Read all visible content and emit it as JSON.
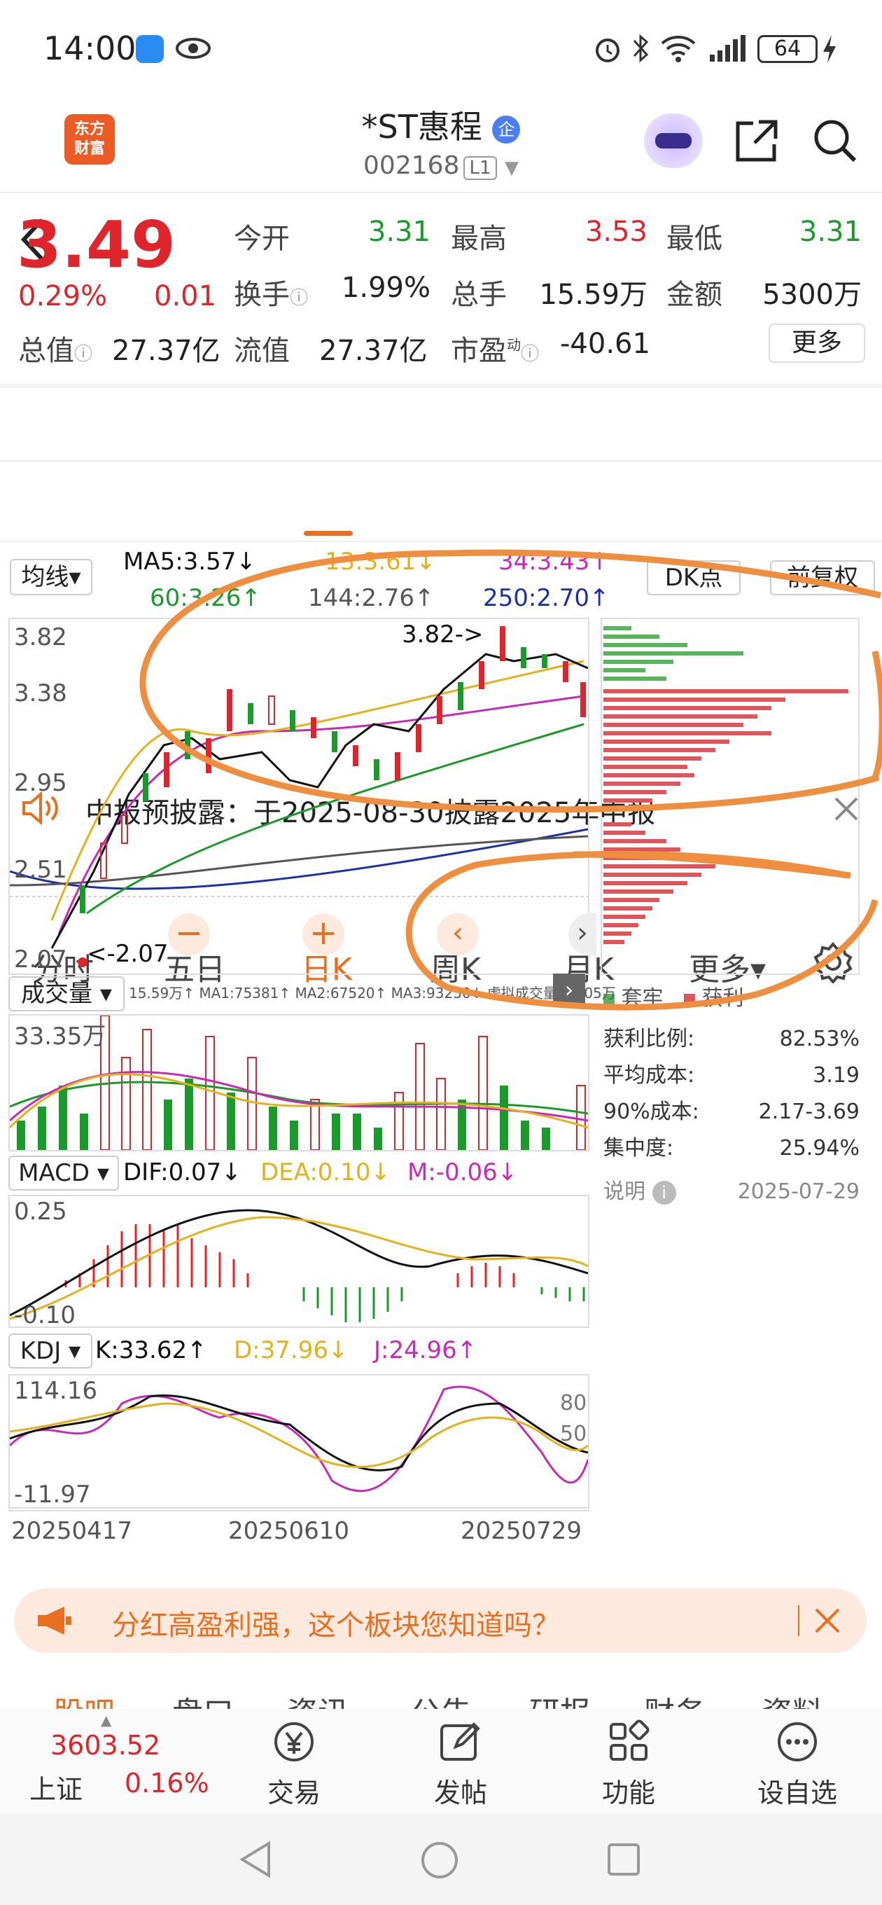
{
  "status": {
    "time": "14:00",
    "battery": "64"
  },
  "header": {
    "back": "<",
    "logo": "东方\n财富",
    "title": "*ST惠程",
    "title_badge": "企",
    "code": "002168",
    "level": "L1"
  },
  "quote": {
    "price": "3.49",
    "change_pct": "0.29%",
    "change": "0.01",
    "open_label": "今开",
    "open": "3.31",
    "high_label": "最高",
    "high": "3.53",
    "low_label": "最低",
    "low": "3.31",
    "turnover_label": "换手",
    "turnover": "1.99%",
    "volume_label": "总手",
    "volume": "15.59万",
    "amount_label": "金额",
    "amount": "5300万",
    "mktcap_label": "总值",
    "mktcap": "27.37亿",
    "float_label": "流值",
    "float": "27.37亿",
    "pe_label": "市盈",
    "pe_sup": "动",
    "pe": "-40.61",
    "more_label": "更多"
  },
  "notice": {
    "text": "中报预披露：于2025-08-30披露2025年中报"
  },
  "tabs": [
    {
      "label": "分时"
    },
    {
      "label": "五日"
    },
    {
      "label": "日K"
    },
    {
      "label": "周K"
    },
    {
      "label": "月K"
    },
    {
      "label": "更多▾"
    }
  ],
  "ma": {
    "selector": "均线▾",
    "ma5": "MA5:3.57↓",
    "ma13": "13:3.61↓",
    "ma34": "34:3.43↑",
    "ma60": "60:3.26↑",
    "ma144": "144:2.76↑",
    "ma250": "250:2.70↑",
    "dk": "DK点",
    "fq": "前复权"
  },
  "kline": {
    "y1": "3.82",
    "y2": "3.38",
    "y3": "2.95",
    "y4": "2.51",
    "y5": "2.07",
    "high_mark": "3.82->",
    "low_mark": "<-2.07"
  },
  "volume": {
    "selector": "成交量",
    "label": "15.59万↑ MA1:75381↑ MA2:67520↑ MA3:93250↓ 虚拟成交量:16.05万",
    "axis": "33.35万"
  },
  "macd": {
    "selector": "MACD",
    "dif": "DIF:0.07↓",
    "dea": "DEA:0.10↓",
    "m": "M:-0.06↓",
    "top": "0.25",
    "bottom": "-0.10"
  },
  "kdj": {
    "selector": "KDJ",
    "k": "K:33.62↑",
    "d": "D:37.96↓",
    "j": "J:24.96↑",
    "top": "114.16",
    "bottom": "-11.97",
    "l80": "80",
    "l50": "50"
  },
  "dates": [
    "20250417",
    "20250610",
    "20250729"
  ],
  "chip": {
    "legend_trapped": "套牢",
    "legend_profit": "获利",
    "rows": [
      {
        "label": "获利比例:",
        "value": "82.53%"
      },
      {
        "label": "平均成本:",
        "value": "3.19"
      },
      {
        "label": "90%成本:",
        "value": "2.17-3.69"
      },
      {
        "label": "集中度:",
        "value": "25.94%"
      }
    ],
    "note": "说明",
    "date": "2025-07-29"
  },
  "promo": {
    "text": "分红高盈利强，这个板块您知道吗？"
  },
  "subtabs": [
    "股吧",
    "盘口",
    "资讯",
    "公告",
    "研报",
    "财务",
    "资料"
  ],
  "bottom": {
    "index_value": "3603.52",
    "index_name": "上证",
    "index_pct": "0.16%",
    "items": [
      {
        "label": "交易"
      },
      {
        "label": "发帖"
      },
      {
        "label": "功能"
      },
      {
        "label": "设自选"
      }
    ]
  },
  "colors": {
    "up": "#e0242b",
    "down": "#1a9a2b",
    "accent": "#e86f1f"
  }
}
